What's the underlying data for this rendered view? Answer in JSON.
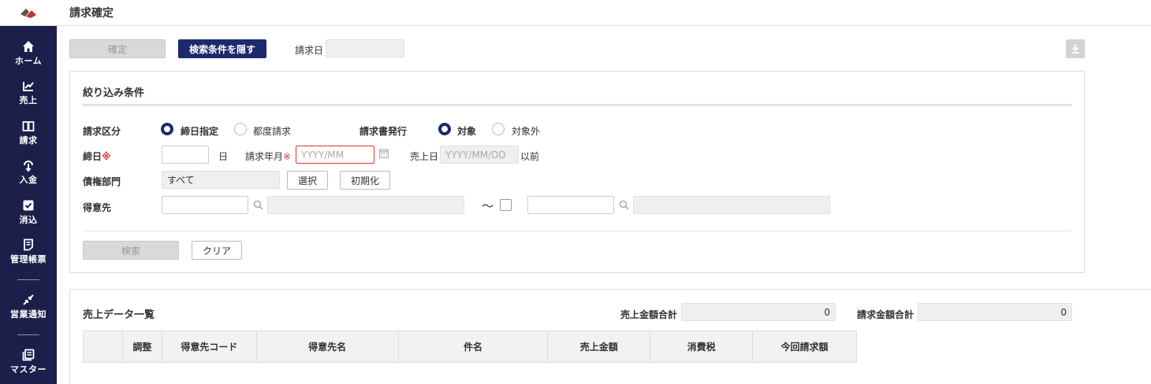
{
  "header": {
    "title": "請求確定"
  },
  "sidebar": {
    "items": [
      {
        "label": "ホーム",
        "icon": "home-icon"
      },
      {
        "label": "売上",
        "icon": "sales-chart-icon"
      },
      {
        "label": "請求",
        "icon": "book-icon"
      },
      {
        "label": "入金",
        "icon": "payment-icon"
      },
      {
        "label": "消込",
        "icon": "check-square-icon"
      },
      {
        "label": "管理帳票",
        "icon": "report-icon"
      },
      {
        "label": "営業通知",
        "icon": "notify-arrows-icon"
      },
      {
        "label": "マスター",
        "icon": "master-stack-icon"
      }
    ]
  },
  "toolbar": {
    "confirm_label": "確定",
    "hide_conditions_label": "検索条件を隠す",
    "billing_date_label": "請求日",
    "billing_date_value": ""
  },
  "filters": {
    "title": "絞り込み条件",
    "billing_type_label": "請求区分",
    "billing_type_options": [
      "締日指定",
      "都度請求"
    ],
    "invoice_issue_label": "請求書発行",
    "invoice_issue_options": [
      "対象",
      "対象外"
    ],
    "closing_day_label": "締日",
    "required_mark": "※",
    "closing_day_value": "",
    "day_unit": "日",
    "billing_month_label": "請求年月",
    "billing_month_placeholder": "YYYY/MM",
    "sales_date_label": "売上日",
    "sales_date_placeholder": "YYYY/MM/DD",
    "sales_date_suffix": "以前",
    "department_label": "債権部門",
    "department_value": "すべて",
    "select_label": "選択",
    "reset_label": "初期化",
    "customer_label": "得意先",
    "range_sep": "～",
    "search_label": "検索",
    "clear_label": "クリア"
  },
  "sales_list": {
    "title": "売上データ一覧",
    "sales_total_label": "売上金額合計",
    "sales_total_value": "0",
    "billing_total_label": "請求金額合計",
    "billing_total_value": "0",
    "columns": [
      "",
      "調整",
      "得意先コード",
      "得意先名",
      "件名",
      "売上金額",
      "消費税",
      "今回請求額"
    ]
  },
  "colors": {
    "sidebar_bg": "#1b1f4a",
    "primary": "#1b2a6b",
    "required": "#dd3333"
  }
}
